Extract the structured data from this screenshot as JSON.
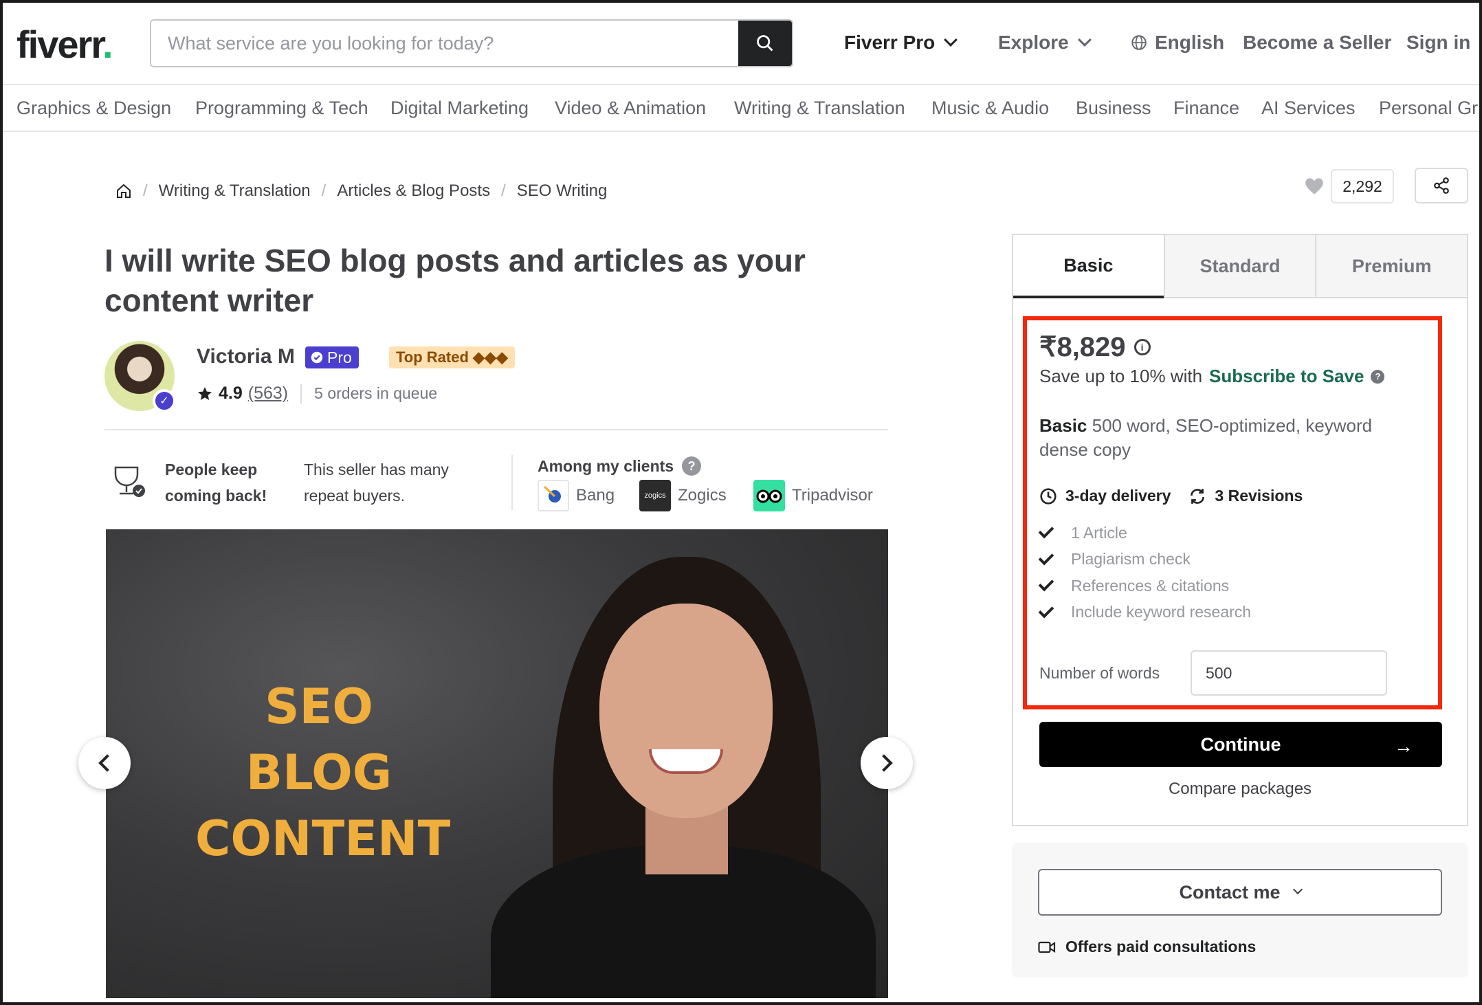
{
  "header": {
    "logo": "fiverr",
    "logo_dot": ".",
    "search_placeholder": "What service are you looking for today?",
    "fiverr_pro": "Fiverr Pro",
    "explore": "Explore",
    "language": "English",
    "become_seller": "Become a Seller",
    "sign_in": "Sign in"
  },
  "categories": [
    "Graphics & Design",
    "Programming & Tech",
    "Digital Marketing",
    "Video & Animation",
    "Writing & Translation",
    "Music & Audio",
    "Business",
    "Finance",
    "AI Services",
    "Personal Gr"
  ],
  "breadcrumb": [
    "Writing & Translation",
    "Articles & Blog Posts",
    "SEO Writing"
  ],
  "favorites_count": "2,292",
  "gig": {
    "title": "I will write SEO blog posts and articles as your content writer"
  },
  "seller": {
    "name": "Victoria M",
    "pro_label": "Pro",
    "top_rated": "Top Rated ◆◆◆",
    "rating": "4.9",
    "reviews": "(563)",
    "queue": "5 orders in queue"
  },
  "repeat": {
    "headline": "People keep coming back!",
    "text": "This seller has many repeat buyers."
  },
  "clients": {
    "title": "Among my clients",
    "items": [
      "Bang",
      "Zogics",
      "Tripadvisor"
    ],
    "zogics_logo": "zogics"
  },
  "hero": {
    "text_line1": "SEO BLOG",
    "text_line2": "CONTENT"
  },
  "package": {
    "tabs": [
      "Basic",
      "Standard",
      "Premium"
    ],
    "price": "₹8,829",
    "save_prefix": "Save up to 10% with",
    "save_link": "Subscribe to Save",
    "desc_bold": "Basic",
    "desc_text": "500 word, SEO-optimized, keyword dense copy",
    "delivery": "3-day delivery",
    "revisions": "3 Revisions",
    "features": [
      "1 Article",
      "Plagiarism check",
      "References & citations",
      "Include keyword research"
    ],
    "words_label": "Number of words",
    "words_value": "500",
    "continue": "Continue",
    "compare": "Compare packages"
  },
  "contact": {
    "button": "Contact me",
    "consult": "Offers paid consultations"
  },
  "colors": {
    "brand_green": "#1dbf73",
    "highlight_red": "#f3280c",
    "pro_purple": "#4a3fcf",
    "link_green": "#1a6b4f"
  }
}
